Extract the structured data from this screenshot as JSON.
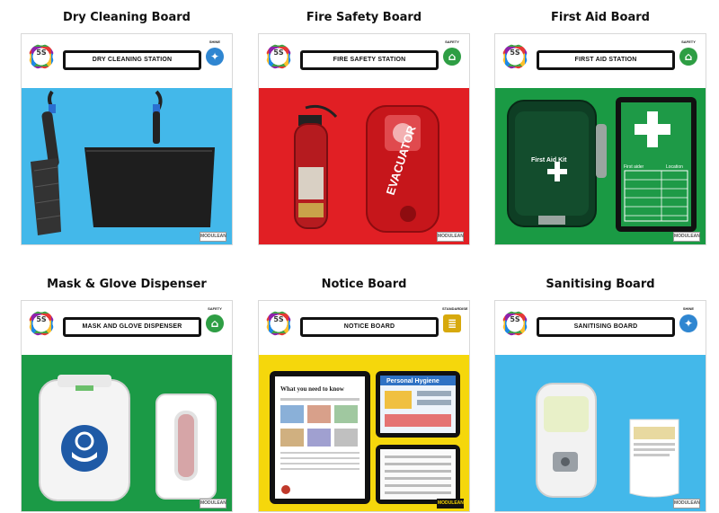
{
  "boards": [
    {
      "caption": "Dry Cleaning Board",
      "station_label": "DRY CLEANING STATION",
      "category_tag": "SHINE",
      "category_icon": "compass-star-icon",
      "panel_color": "#43b8ea",
      "badge_color": "#2f86d1",
      "maker": "MODULEAN"
    },
    {
      "caption": "Fire Safety Board",
      "station_label": "FIRE SAFETY STATION",
      "category_tag": "SAFETY",
      "category_icon": "house-icon",
      "panel_color": "#e11f24",
      "badge_color": "#2e9e44",
      "maker": "MODULEAN",
      "alarm_text": "EVACUATOR"
    },
    {
      "caption": "First Aid Board",
      "station_label": "FIRST AID STATION",
      "category_tag": "SAFETY",
      "category_icon": "house-icon",
      "panel_color": "#1a9a44",
      "badge_color": "#2e9e44",
      "maker": "MODULEAN",
      "kit_label": "First Aid Kit",
      "table_headers": [
        "First aider",
        "Location"
      ]
    },
    {
      "caption": "Mask & Glove Dispenser",
      "station_label": "MASK AND GLOVE DISPENSER",
      "category_tag": "SAFETY",
      "category_icon": "house-icon",
      "panel_color": "#1b9a46",
      "badge_color": "#2e9e44",
      "maker": "MODULEAN"
    },
    {
      "caption": "Notice Board",
      "station_label": "NOTICE BOARD",
      "category_tag": "STANDARDISE",
      "category_icon": "document-icon",
      "panel_color": "#f5d70c",
      "badge_color": "#d7a90c",
      "maker": "MODULEAN",
      "poster_heading": "What you need to know",
      "poster2_heading": "Personal Hygiene"
    },
    {
      "caption": "Sanitising Board",
      "station_label": "SANITISING BOARD",
      "category_tag": "SHINE",
      "category_icon": "compass-star-icon",
      "panel_color": "#43b8ea",
      "badge_color": "#2f86d1",
      "maker": "MODULEAN"
    }
  ],
  "logo_text": "5S"
}
